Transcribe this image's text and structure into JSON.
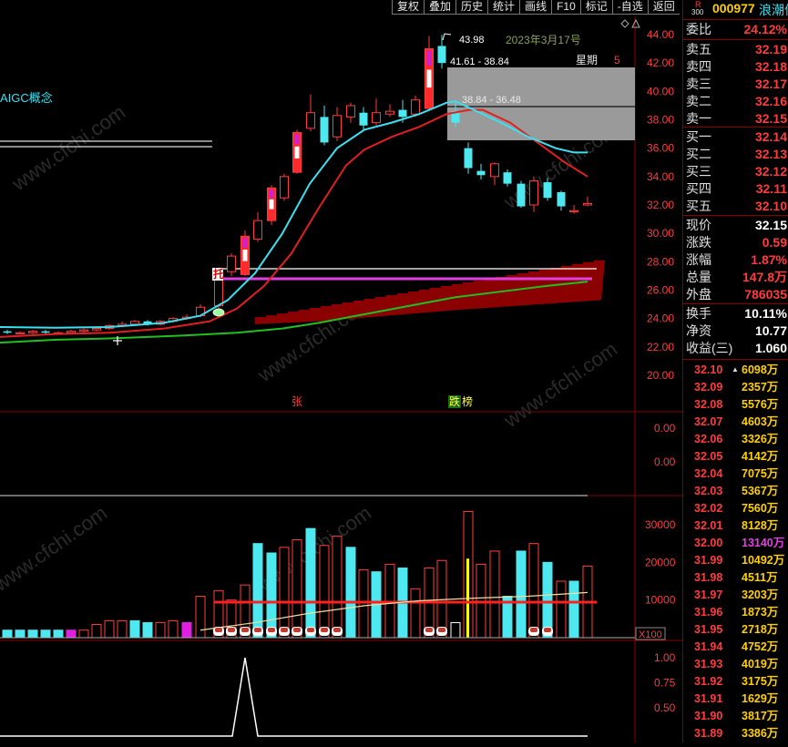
{
  "toolbar": {
    "buttons": [
      "复权",
      "叠加",
      "历史",
      "统计",
      "画线",
      "F10",
      "标记",
      "-自选",
      "返回"
    ]
  },
  "sector_label": "AIGC概念",
  "watermark": "www.cfchi.com",
  "price_axis": [
    "44.00",
    "42.00",
    "40.00",
    "38.00",
    "36.00",
    "34.00",
    "32.00",
    "30.00",
    "28.00",
    "26.00",
    "24.00",
    "22.00",
    "20.00"
  ],
  "annotations": {
    "high_label": "43.98",
    "date_label": "2023年3月17号",
    "range_1": "41.61 - 38.84",
    "range_2": "38.84 - 36.48",
    "weekday_label": "星期",
    "weekday_value": "5",
    "tuo": "托",
    "zhang": "张",
    "die": "跌",
    "bang": "榜"
  },
  "indicator_axis": [
    "0.00",
    "0.00"
  ],
  "volume_axis": [
    "30000",
    "20000",
    "10000"
  ],
  "volume_unit": "X100",
  "bottom_axis": [
    "1.00",
    "0.75",
    "0.50"
  ],
  "quote": {
    "r_label": "R",
    "r_num": "300",
    "code": "000977",
    "name": "浪潮信息",
    "weibi_label": "委比",
    "weibi_value": "24.12%",
    "sell_levels": [
      {
        "label": "卖五",
        "price": "32.19"
      },
      {
        "label": "卖四",
        "price": "32.18"
      },
      {
        "label": "卖三",
        "price": "32.17"
      },
      {
        "label": "卖二",
        "price": "32.16"
      },
      {
        "label": "卖一",
        "price": "32.15"
      }
    ],
    "buy_levels": [
      {
        "label": "买一",
        "price": "32.14"
      },
      {
        "label": "买二",
        "price": "32.13"
      },
      {
        "label": "买三",
        "price": "32.12"
      },
      {
        "label": "买四",
        "price": "32.11"
      },
      {
        "label": "买五",
        "price": "32.10"
      }
    ],
    "stats": [
      {
        "label": "现价",
        "value": "32.15"
      },
      {
        "label": "涨跌",
        "value": "0.59"
      },
      {
        "label": "涨幅",
        "value": "1.87%"
      },
      {
        "label": "总量",
        "value": "147.8万"
      },
      {
        "label": "外盘",
        "value": "786035"
      }
    ],
    "stats2": [
      {
        "label": "换手",
        "value": "10.11%"
      },
      {
        "label": "净资",
        "value": "10.77"
      },
      {
        "label": "收益(三)",
        "value": "1.060"
      }
    ]
  },
  "ticks": [
    {
      "price": "32.10",
      "vol": "6098万"
    },
    {
      "price": "32.09",
      "vol": "2357万"
    },
    {
      "price": "32.08",
      "vol": "5576万"
    },
    {
      "price": "32.07",
      "vol": "4603万"
    },
    {
      "price": "32.06",
      "vol": "3326万"
    },
    {
      "price": "32.05",
      "vol": "4142万"
    },
    {
      "price": "32.04",
      "vol": "7075万"
    },
    {
      "price": "32.03",
      "vol": "5367万"
    },
    {
      "price": "32.02",
      "vol": "7560万"
    },
    {
      "price": "32.01",
      "vol": "8128万"
    },
    {
      "price": "32.00",
      "vol": "13140万"
    },
    {
      "price": "31.99",
      "vol": "10492万"
    },
    {
      "price": "31.98",
      "vol": "4511万"
    },
    {
      "price": "31.97",
      "vol": "3203万"
    },
    {
      "price": "31.96",
      "vol": "1873万"
    },
    {
      "price": "31.95",
      "vol": "2718万"
    },
    {
      "price": "31.94",
      "vol": "4752万"
    },
    {
      "price": "31.93",
      "vol": "4019万"
    },
    {
      "price": "31.92",
      "vol": "3175万"
    },
    {
      "price": "31.91",
      "vol": "1629万"
    },
    {
      "price": "31.90",
      "vol": "3817万"
    },
    {
      "price": "31.89",
      "vol": "3386万"
    }
  ],
  "colors": {
    "up": "#ff3c3c",
    "down": "#4de8f0",
    "ma_cyan": "#3ce0f0",
    "ma_red": "#e02020",
    "ma_green": "#20c020",
    "band": "#8b0000",
    "magenta": "#e040e0"
  }
}
